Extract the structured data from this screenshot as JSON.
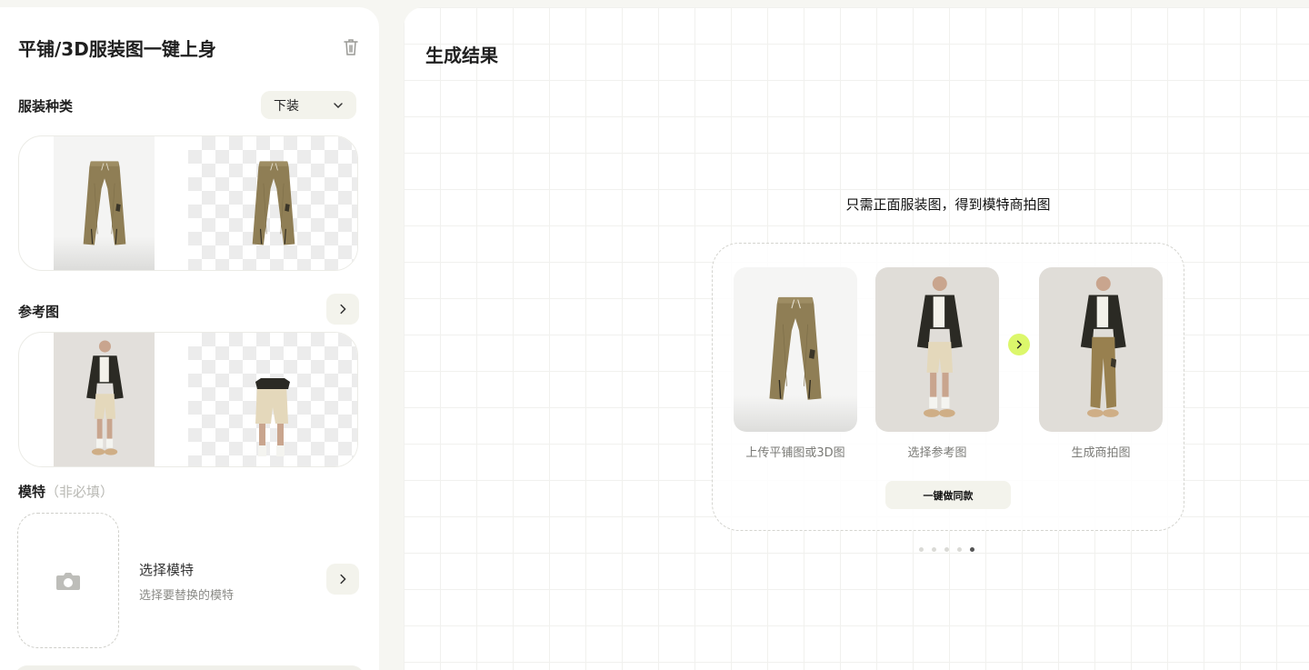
{
  "left": {
    "title": "平铺/3D服装图一键上身",
    "clothing_type": {
      "label": "服装种类",
      "selected": "下装"
    },
    "reference": {
      "label": "参考图"
    },
    "model": {
      "label": "模特",
      "optional": "（非必填）",
      "select_title": "选择模特",
      "select_subtitle": "选择要替换的模特"
    }
  },
  "right": {
    "title": "生成结果",
    "tagline": "只需正面服装图，得到模特商拍图",
    "steps": [
      {
        "caption": "上传平铺图或3D图"
      },
      {
        "caption": "选择参考图"
      },
      {
        "caption": "生成商拍图"
      }
    ],
    "cta": "一键做同款",
    "pager": {
      "count": 5,
      "active_index": 4
    }
  },
  "colors": {
    "accent": "#dcf76b",
    "panel": "#ffffff",
    "bg": "#f6f6f2",
    "chip": "#f3f3ec"
  },
  "icons": [
    "trash-icon",
    "chevron-down-icon",
    "chevron-right-icon",
    "camera-icon"
  ]
}
